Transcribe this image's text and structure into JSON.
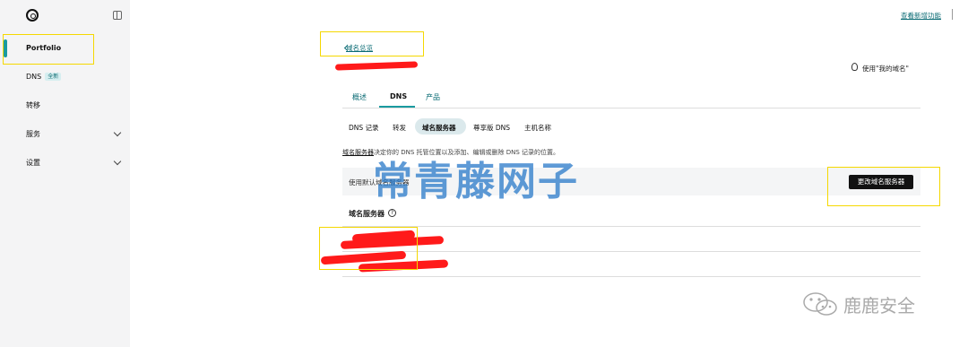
{
  "sidebar": {
    "items": [
      {
        "label": "Portfolio"
      },
      {
        "label": "DNS",
        "badge": "全新"
      },
      {
        "label": "转移"
      },
      {
        "label": "服务"
      },
      {
        "label": "设置"
      }
    ]
  },
  "header": {
    "whats_new": "查看新增功能"
  },
  "main": {
    "back_label": "域名总览",
    "tip_label": "使用\"我的域名\"",
    "tabs": [
      {
        "label": "概述"
      },
      {
        "label": "DNS"
      },
      {
        "label": "产品"
      }
    ],
    "subtabs": [
      {
        "label": "DNS 记录"
      },
      {
        "label": "转发"
      },
      {
        "label": "域名服务器"
      },
      {
        "label": "尊享版 DNS"
      },
      {
        "label": "主机名称"
      }
    ],
    "description_link": "域名服务器",
    "description_text": "决定你的 DNS 托管位置以及添加、编辑或删除 DNS 记录的位置。",
    "current_ns_text": "使用默认域名服务器",
    "change_ns_button": "更改域名服务器",
    "ns_section_title": "域名服务器",
    "help_icon_glyph": "?"
  },
  "watermark": {
    "text": "常青藤网子",
    "wechat_account": "鹿鹿安全"
  },
  "colors": {
    "accent": "#1a9aa0",
    "link": "#0a6b74",
    "highlight": "#f5d800",
    "redaction": "#ff1a1a"
  }
}
